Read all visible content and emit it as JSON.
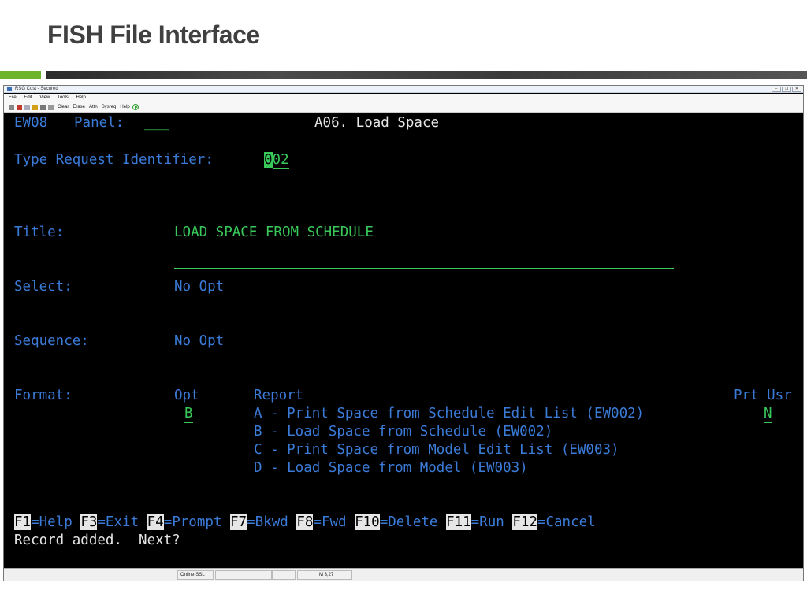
{
  "slide": {
    "title": "FISH File Interface"
  },
  "window": {
    "title": "RSG Cost - Secured",
    "menu": [
      "File",
      "Edit",
      "View",
      "Tools",
      "Help"
    ],
    "toolbar": {
      "clear": "Clear",
      "erase": "Erase",
      "attn": "Attn",
      "sysreq": "Sysreq",
      "help": "Help"
    }
  },
  "terminal": {
    "screen_id": "EW08",
    "panel_label": "Panel:",
    "panel_value": "___",
    "panel_title": "A06. Load Space",
    "type_request_label": "Type Request Identifier:",
    "type_request_cursor": "0",
    "type_request_rest": "02",
    "title_label": "Title:",
    "title_value": "LOAD SPACE FROM SCHEDULE",
    "select_label": "Select:",
    "select_value": "No Opt",
    "sequence_label": "Sequence:",
    "sequence_value": "No Opt",
    "format_label": "Format:",
    "opt_header": "Opt",
    "report_header": "Report",
    "prt_usr_header": "Prt Usr",
    "opt_value": "B",
    "prt_usr_value": "N",
    "reports": [
      "A - Print Space from Schedule Edit List (EW002)",
      "B - Load Space from Schedule (EW002)",
      "C - Print Space from Model Edit List (EW003)",
      "D - Load Space from Model (EW003)"
    ],
    "fkeys": [
      {
        "key": "F1",
        "label": "=Help"
      },
      {
        "key": "F3",
        "label": "=Exit"
      },
      {
        "key": "F4",
        "label": "=Prompt"
      },
      {
        "key": "F7",
        "label": "=Bkwd"
      },
      {
        "key": "F8",
        "label": "=Fwd"
      },
      {
        "key": "F10",
        "label": "=Delete"
      },
      {
        "key": "F11",
        "label": "=Run"
      },
      {
        "key": "F12",
        "label": "=Cancel"
      }
    ],
    "message": "Record added.  Next?"
  },
  "status": {
    "connection": "Online-SSL",
    "mode": "M",
    "position": "3,27"
  },
  "colors": {
    "field_text": "#39c85a",
    "label_text": "#3b7bd8",
    "background": "#000000",
    "accent": "#6bb42c"
  }
}
